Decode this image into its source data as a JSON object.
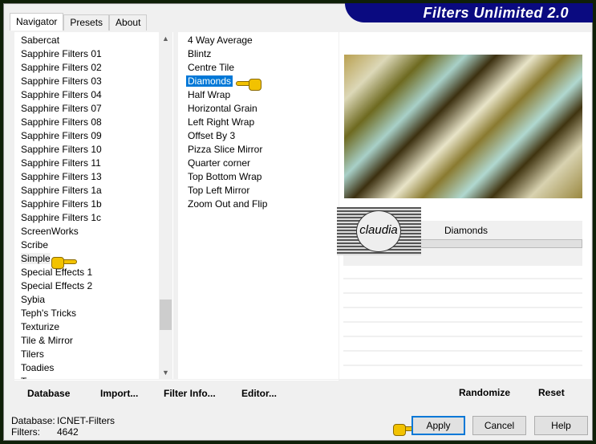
{
  "app": {
    "title": "Filters Unlimited 2.0"
  },
  "tabs": [
    {
      "label": "Navigator"
    },
    {
      "label": "Presets"
    },
    {
      "label": "About"
    }
  ],
  "categories": [
    "Sabercat",
    "Sapphire Filters 01",
    "Sapphire Filters 02",
    "Sapphire Filters 03",
    "Sapphire Filters 04",
    "Sapphire Filters 07",
    "Sapphire Filters 08",
    "Sapphire Filters 09",
    "Sapphire Filters 10",
    "Sapphire Filters 11",
    "Sapphire Filters 13",
    "Sapphire Filters 1a",
    "Sapphire Filters 1b",
    "Sapphire Filters 1c",
    "ScreenWorks",
    "Scribe",
    "Simple",
    "Special Effects 1",
    "Special Effects 2",
    "Sybia",
    "Teph's Tricks",
    "Texturize",
    "Tile & Mirror",
    "Tilers",
    "Toadies",
    "Tramages"
  ],
  "selected_category": "Simple",
  "filters": [
    "4 Way Average",
    "Blintz",
    "Centre Tile",
    "Diamonds",
    "Half Wrap",
    "Horizontal Grain",
    "Left Right Wrap",
    "Offset By 3",
    "Pizza Slice Mirror",
    "Quarter corner",
    "Top Bottom Wrap",
    "Top Left Mirror",
    "Zoom Out and Flip"
  ],
  "selected_filter": "Diamonds",
  "preview": {
    "filter_name": "Diamonds",
    "watermark": "claudia"
  },
  "toolbar": {
    "database": "Database",
    "import": "Import...",
    "filter_info": "Filter Info...",
    "editor": "Editor...",
    "randomize": "Randomize",
    "reset": "Reset"
  },
  "status": {
    "database_label": "Database:",
    "database_value": "ICNET-Filters",
    "filters_label": "Filters:",
    "filters_value": "4642"
  },
  "buttons": {
    "apply": "Apply",
    "cancel": "Cancel",
    "help": "Help"
  },
  "colors": {
    "selection": "#0078d7",
    "banner": "#0a0a80"
  }
}
